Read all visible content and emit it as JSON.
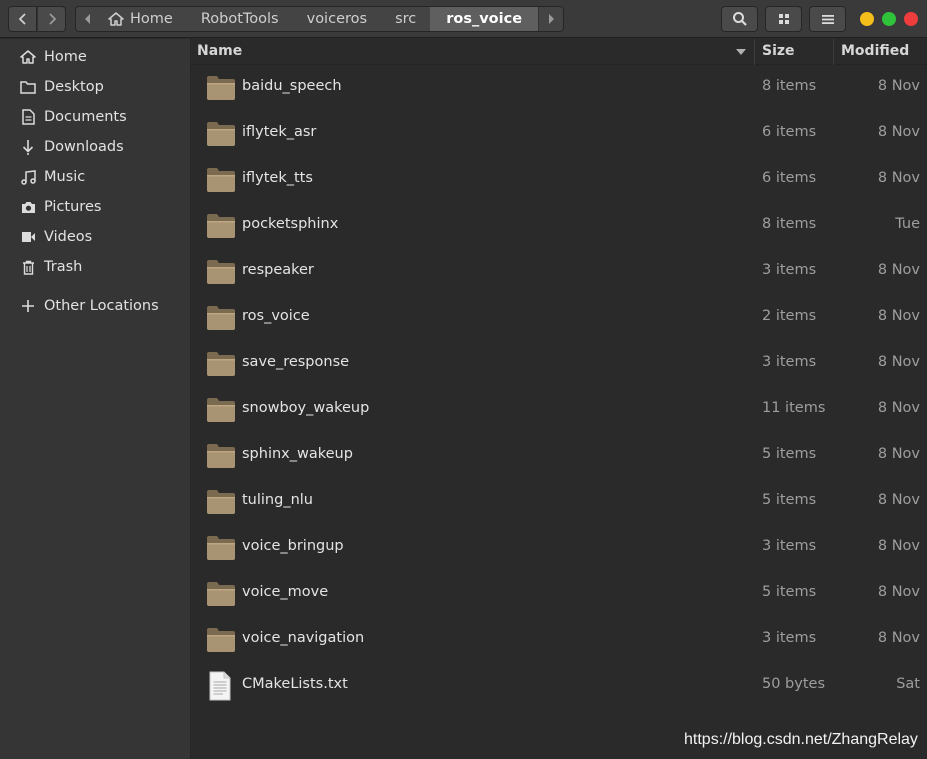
{
  "toolbar": {
    "back_icon": "chevron-left-icon",
    "forward_icon": "chevron-right-icon",
    "search_icon": "search-icon",
    "view_icon": "grid-view-icon",
    "menu_icon": "hamburger-menu-icon"
  },
  "pathbar": {
    "crumbs": [
      "Home",
      "RobotTools",
      "voiceros",
      "src",
      "ros_voice"
    ],
    "active_index": 4
  },
  "window_controls": {
    "minimize_color": "#f4bf1a",
    "maximize_color": "#2ec339",
    "close_color": "#ef3d3d"
  },
  "sidebar": {
    "items": [
      {
        "label": "Home",
        "icon": "home-icon"
      },
      {
        "label": "Desktop",
        "icon": "folder-icon"
      },
      {
        "label": "Documents",
        "icon": "document-icon"
      },
      {
        "label": "Downloads",
        "icon": "download-icon"
      },
      {
        "label": "Music",
        "icon": "music-icon"
      },
      {
        "label": "Pictures",
        "icon": "camera-icon"
      },
      {
        "label": "Videos",
        "icon": "video-icon"
      },
      {
        "label": "Trash",
        "icon": "trash-icon"
      }
    ],
    "other_locations": {
      "label": "Other Locations",
      "icon": "plus-icon"
    }
  },
  "columns": {
    "name": "Name",
    "size": "Size",
    "modified": "Modified",
    "sort": "descending"
  },
  "files": [
    {
      "name": "baidu_speech",
      "size": "8 items",
      "modified": "8 Nov",
      "type": "folder"
    },
    {
      "name": "iflytek_asr",
      "size": "6 items",
      "modified": "8 Nov",
      "type": "folder"
    },
    {
      "name": "iflytek_tts",
      "size": "6 items",
      "modified": "8 Nov",
      "type": "folder"
    },
    {
      "name": "pocketsphinx",
      "size": "8 items",
      "modified": "Tue",
      "type": "folder"
    },
    {
      "name": "respeaker",
      "size": "3 items",
      "modified": "8 Nov",
      "type": "folder"
    },
    {
      "name": "ros_voice",
      "size": "2 items",
      "modified": "8 Nov",
      "type": "folder"
    },
    {
      "name": "save_response",
      "size": "3 items",
      "modified": "8 Nov",
      "type": "folder"
    },
    {
      "name": "snowboy_wakeup",
      "size": "11 items",
      "modified": "8 Nov",
      "type": "folder"
    },
    {
      "name": "sphinx_wakeup",
      "size": "5 items",
      "modified": "8 Nov",
      "type": "folder"
    },
    {
      "name": "tuling_nlu",
      "size": "5 items",
      "modified": "8 Nov",
      "type": "folder"
    },
    {
      "name": "voice_bringup",
      "size": "3 items",
      "modified": "8 Nov",
      "type": "folder"
    },
    {
      "name": "voice_move",
      "size": "5 items",
      "modified": "8 Nov",
      "type": "folder"
    },
    {
      "name": "voice_navigation",
      "size": "3 items",
      "modified": "8 Nov",
      "type": "folder"
    },
    {
      "name": "CMakeLists.txt",
      "size": "50 bytes",
      "modified": "Sat",
      "type": "text-file"
    }
  ],
  "watermark": "https://blog.csdn.net/ZhangRelay"
}
